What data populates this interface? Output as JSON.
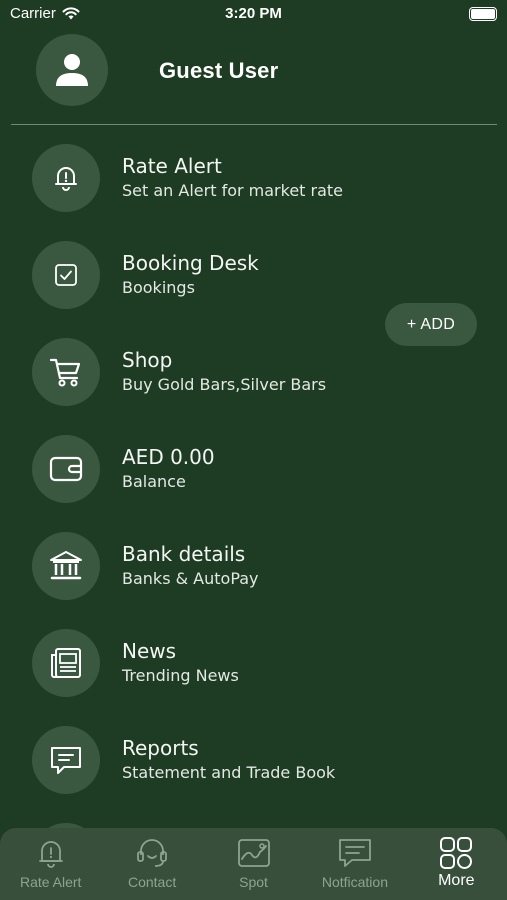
{
  "status_bar": {
    "carrier": "Carrier",
    "time": "3:20 PM"
  },
  "profile": {
    "name": "Guest User",
    "icon": "user-icon"
  },
  "menu": [
    {
      "title": "Rate Alert",
      "subtitle": "Set an Alert for market rate",
      "icon": "bell-alert-icon"
    },
    {
      "title": "Booking Desk",
      "subtitle": "Bookings",
      "icon": "checkbox-icon"
    },
    {
      "title": "Shop",
      "subtitle": "Buy Gold Bars,Silver Bars",
      "icon": "cart-icon"
    },
    {
      "title": "AED 0.00",
      "subtitle": "Balance",
      "icon": "wallet-icon"
    },
    {
      "title": "Bank details",
      "subtitle": "Banks & AutoPay",
      "icon": "bank-icon"
    },
    {
      "title": "News",
      "subtitle": "Trending News",
      "icon": "newspaper-icon"
    },
    {
      "title": "Reports",
      "subtitle": "Statement and Trade Book",
      "icon": "message-report-icon"
    }
  ],
  "add_button": {
    "label": "+ ADD"
  },
  "tabs": [
    {
      "label": "Rate Alert",
      "icon": "bell-alert-icon",
      "active": false
    },
    {
      "label": "Contact",
      "icon": "headset-icon",
      "active": false
    },
    {
      "label": "Spot",
      "icon": "chart-image-icon",
      "active": false
    },
    {
      "label": "Notfication",
      "icon": "message-icon",
      "active": false
    },
    {
      "label": "More",
      "icon": "grid-icon",
      "active": true
    }
  ],
  "colors": {
    "background": "#1e3b23",
    "circle": "#3a5740",
    "tabbar": "#384f3c",
    "inactive_tab": "#8fa393"
  }
}
